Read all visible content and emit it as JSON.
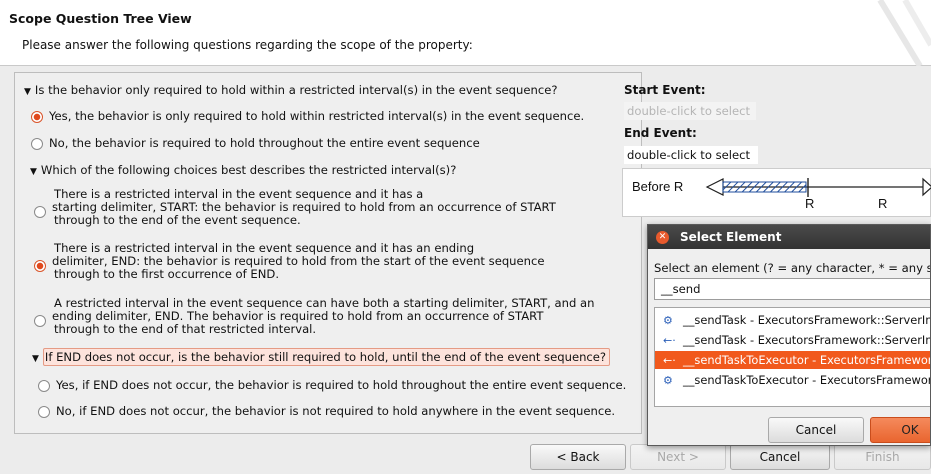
{
  "header": {
    "title": "Scope Question Tree View",
    "subtitle": "Please answer the following questions regarding the scope of the property:"
  },
  "questions": {
    "q1": {
      "text": "Is the behavior only required to hold within a restricted interval(s) in the event sequence?",
      "options": [
        {
          "label": "Yes, the behavior is only required to hold within restricted interval(s) in the event sequence.",
          "selected": true
        },
        {
          "label": "No, the behavior is required to hold throughout the entire event sequence",
          "selected": false
        }
      ]
    },
    "q2": {
      "text": "Which of the following choices best describes the restricted interval(s)?",
      "options": [
        {
          "lines": [
            "There is a restricted interval in the event sequence and it has a",
            "starting delimiter, START: the behavior is required to hold from an occurrence of START",
            "through to the end of the event sequence."
          ],
          "selected": false
        },
        {
          "lines": [
            "There is a restricted interval in the event sequence and it has an ending",
            "delimiter, END: the behavior is required to hold from the start of the event sequence",
            "through to the first occurrence of END."
          ],
          "selected": true
        },
        {
          "lines": [
            "A restricted interval in the event sequence can have both a starting delimiter, START, and an",
            "ending delimiter, END. The behavior is required to hold from an occurrence of START",
            "through to the end of that restricted interval."
          ],
          "selected": false
        }
      ]
    },
    "q3": {
      "text": "If END does not occur, is the behavior still required to hold, until the end of the event sequence?",
      "options": [
        {
          "label": "Yes, if END does not occur, the behavior is required to hold throughout the entire event sequence.",
          "selected": false
        },
        {
          "label": "No, if END does not occur, the behavior is not required to hold anywhere in the event sequence.",
          "selected": false
        }
      ]
    }
  },
  "events": {
    "start_label": "Start Event:",
    "start_value": "double-click to select",
    "end_label": "End Event:",
    "end_value": "double-click to select"
  },
  "diagram": {
    "label": "Before R",
    "marker1": "R",
    "marker2": "R"
  },
  "wizard_buttons": {
    "back": "< Back",
    "next": "Next >",
    "cancel": "Cancel",
    "finish": "Finish"
  },
  "dialog": {
    "title": "Select Element",
    "prompt": "Select an element (? = any character, * = any string)",
    "search_value": "__send",
    "items": [
      {
        "text": "__sendTask - ExecutorsFramework::ServerImpl",
        "icon": "method-icon",
        "selected": false
      },
      {
        "text": "__sendTask - ExecutorsFramework::ServerImpl",
        "icon": "message-icon",
        "selected": false
      },
      {
        "text": "__sendTaskToExecutor - ExecutorsFramework",
        "icon": "message-icon",
        "selected": true
      },
      {
        "text": "__sendTaskToExecutor - ExecutorsFramework",
        "icon": "method-icon",
        "selected": false
      }
    ],
    "cancel": "Cancel",
    "ok": "OK"
  }
}
